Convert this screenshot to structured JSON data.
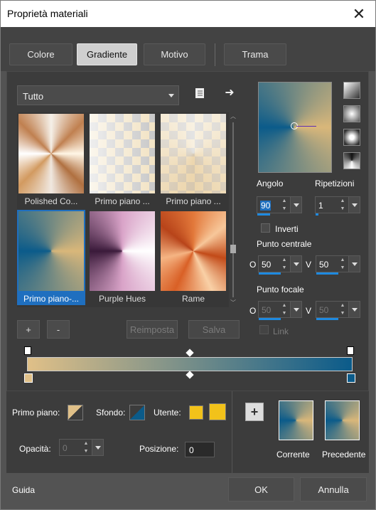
{
  "window": {
    "title": "Proprietà materiali",
    "close": "✕"
  },
  "tabs": [
    {
      "label": "Colore"
    },
    {
      "label": "Gradiente"
    },
    {
      "label": "Motivo"
    },
    {
      "label": "Trama"
    }
  ],
  "filter": {
    "value": "Tutto"
  },
  "thumbnails": [
    {
      "label": "Polished Co..."
    },
    {
      "label": "Primo piano ..."
    },
    {
      "label": "Primo piano ..."
    },
    {
      "label": "Primo piano-..."
    },
    {
      "label": "Purple Hues"
    },
    {
      "label": "Rame"
    }
  ],
  "buttons": {
    "add": "+",
    "remove": "-",
    "reset": "Reimposta",
    "save": "Salva"
  },
  "fields": {
    "angle_label": "Angolo",
    "angle_value": "90",
    "repeat_label": "Ripetizioni",
    "repeat_value": "1",
    "invert_label": "Inverti",
    "center_label": "Punto centrale",
    "center_o_label": "O",
    "center_o_value": "50",
    "center_v_label": "V",
    "center_v_value": "50",
    "focal_label": "Punto focale",
    "focal_o_label": "O",
    "focal_o_value": "50",
    "focal_v_label": "V",
    "focal_v_value": "50",
    "link_label": "Link"
  },
  "bottom": {
    "primo_label": "Primo piano:",
    "sfondo_label": "Sfondo:",
    "utente_label": "Utente:",
    "opacity_label": "Opacità:",
    "opacity_value": "0",
    "position_label": "Posizione:",
    "position_value": "0",
    "current_label": "Corrente",
    "previous_label": "Precedente"
  },
  "footer": {
    "help": "Guida",
    "ok": "OK",
    "cancel": "Annulla"
  },
  "colors": {
    "gradient_start": "#e0c088",
    "gradient_end": "#0b5b8a",
    "user": "#f2c21a",
    "selection": "#1f6fbf"
  }
}
